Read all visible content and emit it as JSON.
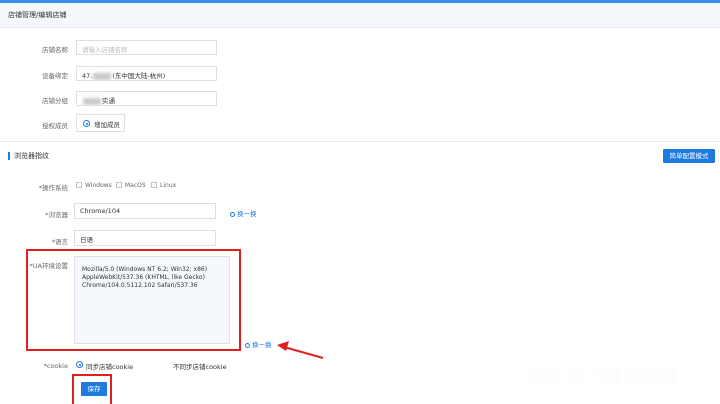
{
  "breadcrumb": "店铺管理/编辑店铺",
  "fields": {
    "store_name": {
      "label": "店铺名称",
      "placeholder": "请输入店铺名称"
    },
    "device_binding": {
      "label": "设备绑定",
      "value_prefix": "47.",
      "value_suffix": "(东中国大陆-杭州)"
    },
    "store_group": {
      "label": "店铺分组",
      "value_suffix": "实通"
    },
    "authorization": {
      "label": "授权成员",
      "button": "增加成员"
    }
  },
  "fingerprint_section": {
    "title": "浏览器指纹",
    "simple_mode_button": "简单配置模式"
  },
  "os": {
    "label": "*操作系统",
    "options": [
      "Windows",
      "MacOS",
      "Linux"
    ]
  },
  "browser": {
    "label": "*浏览器",
    "value": "Chrome/104",
    "refresh": "换一换"
  },
  "language": {
    "label": "*语言",
    "value": "日语"
  },
  "ua": {
    "label": "*UA环境设置",
    "value": "Mozilla/5.0 (Windows NT 6.2; Win32; x86)\nAppleWebKit/537.36 (KHTML, like Gecko)\nChrome/104.0.5112.102 Safari/537.36",
    "refresh": "换一换"
  },
  "cookie": {
    "label": "*cookie",
    "option_sync": "同步店铺cookie",
    "option_nosync": "不同步店铺cookie"
  },
  "save_button": "保存",
  "watermark": "知乎 @飞跨浏览器",
  "colors": {
    "accent": "#1f7ae0",
    "highlight": "#e02020"
  }
}
